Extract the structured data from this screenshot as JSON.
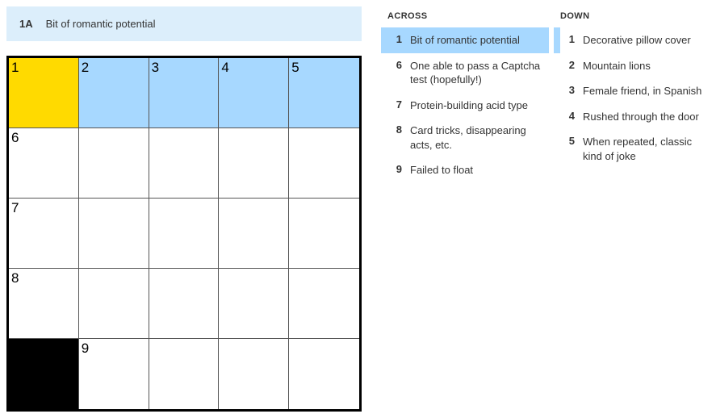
{
  "current_clue": {
    "id": "1A",
    "text": "Bit of romantic potential"
  },
  "grid": {
    "rows": 5,
    "cols": 5,
    "cells": [
      [
        {
          "num": "1",
          "state": "cursor"
        },
        {
          "num": "2",
          "state": "highlight"
        },
        {
          "num": "3",
          "state": "highlight"
        },
        {
          "num": "4",
          "state": "highlight"
        },
        {
          "num": "5",
          "state": "highlight"
        }
      ],
      [
        {
          "num": "6",
          "state": ""
        },
        {
          "num": "",
          "state": ""
        },
        {
          "num": "",
          "state": ""
        },
        {
          "num": "",
          "state": ""
        },
        {
          "num": "",
          "state": ""
        }
      ],
      [
        {
          "num": "7",
          "state": ""
        },
        {
          "num": "",
          "state": ""
        },
        {
          "num": "",
          "state": ""
        },
        {
          "num": "",
          "state": ""
        },
        {
          "num": "",
          "state": ""
        }
      ],
      [
        {
          "num": "8",
          "state": ""
        },
        {
          "num": "",
          "state": ""
        },
        {
          "num": "",
          "state": ""
        },
        {
          "num": "",
          "state": ""
        },
        {
          "num": "",
          "state": ""
        }
      ],
      [
        {
          "num": "",
          "state": "block"
        },
        {
          "num": "9",
          "state": ""
        },
        {
          "num": "",
          "state": ""
        },
        {
          "num": "",
          "state": ""
        },
        {
          "num": "",
          "state": ""
        }
      ]
    ]
  },
  "headings": {
    "across": "ACROSS",
    "down": "DOWN"
  },
  "clues": {
    "across": [
      {
        "num": "1",
        "text": "Bit of romantic potential",
        "status": "active"
      },
      {
        "num": "6",
        "text": "One able to pass a Captcha test (hopefully!)",
        "status": ""
      },
      {
        "num": "7",
        "text": "Protein-building acid type",
        "status": ""
      },
      {
        "num": "8",
        "text": "Card tricks, disappearing acts, etc.",
        "status": ""
      },
      {
        "num": "9",
        "text": "Failed to float",
        "status": ""
      }
    ],
    "down": [
      {
        "num": "1",
        "text": "Decorative pillow cover",
        "status": "sibling"
      },
      {
        "num": "2",
        "text": "Mountain lions",
        "status": ""
      },
      {
        "num": "3",
        "text": "Female friend, in Spanish",
        "status": ""
      },
      {
        "num": "4",
        "text": "Rushed through the door",
        "status": ""
      },
      {
        "num": "5",
        "text": "When repeated, classic kind of joke",
        "status": ""
      }
    ]
  }
}
